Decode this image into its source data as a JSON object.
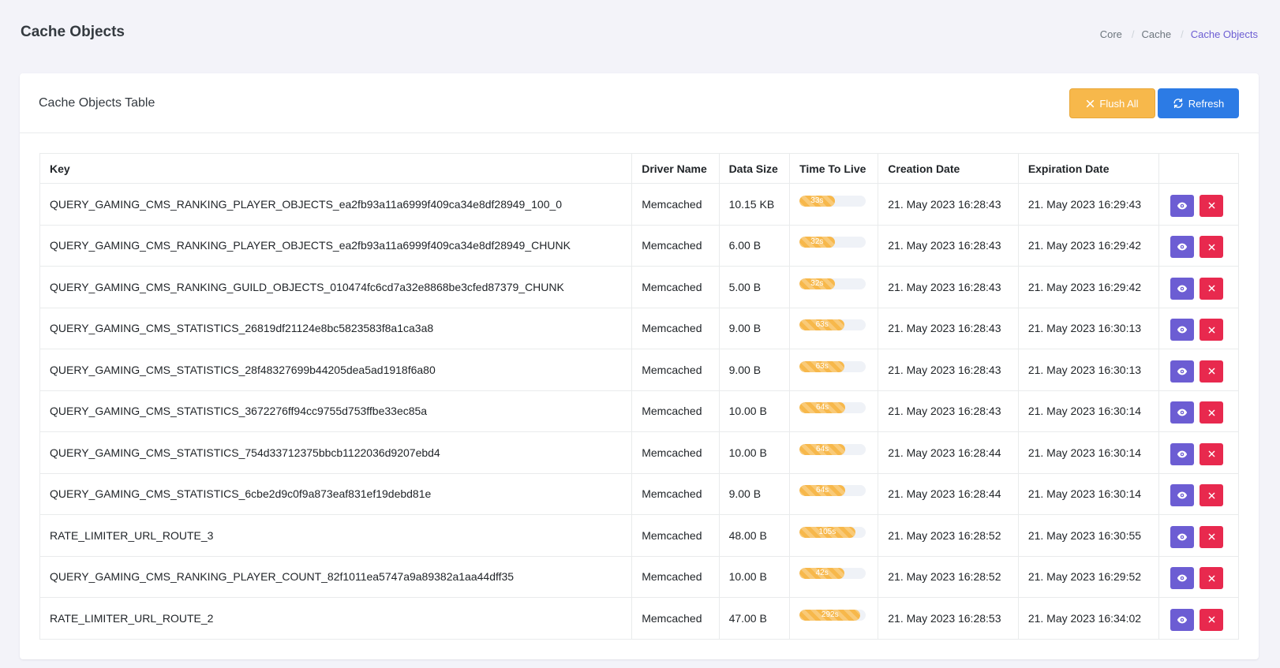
{
  "header": {
    "title": "Cache Objects",
    "breadcrumb": [
      "Core",
      "Cache",
      "Cache Objects"
    ]
  },
  "card": {
    "title": "Cache Objects Table",
    "flush_label": "Flush All",
    "refresh_label": "Refresh"
  },
  "table": {
    "columns": [
      "Key",
      "Driver Name",
      "Data Size",
      "Time To Live",
      "Creation Date",
      "Expiration Date",
      ""
    ],
    "rows": [
      {
        "key": "QUERY_GAMING_CMS_RANKING_PLAYER_OBJECTS_ea2fb93a11a6999f409ca34e8df28949_100_0",
        "driver": "Memcached",
        "size": "10.15 KB",
        "ttl": "33s",
        "ttl_fraction": 0.53,
        "created": "21. May 2023 16:28:43",
        "expires": "21. May 2023 16:29:43"
      },
      {
        "key": "QUERY_GAMING_CMS_RANKING_PLAYER_OBJECTS_ea2fb93a11a6999f409ca34e8df28949_CHUNK",
        "driver": "Memcached",
        "size": "6.00 B",
        "ttl": "32s",
        "ttl_fraction": 0.53,
        "created": "21. May 2023 16:28:43",
        "expires": "21. May 2023 16:29:42"
      },
      {
        "key": "QUERY_GAMING_CMS_RANKING_GUILD_OBJECTS_010474fc6cd7a32e8868be3cfed87379_CHUNK",
        "driver": "Memcached",
        "size": "5.00 B",
        "ttl": "32s",
        "ttl_fraction": 0.53,
        "created": "21. May 2023 16:28:43",
        "expires": "21. May 2023 16:29:42"
      },
      {
        "key": "QUERY_GAMING_CMS_STATISTICS_26819df21124e8bc5823583f8a1ca3a8",
        "driver": "Memcached",
        "size": "9.00 B",
        "ttl": "63s",
        "ttl_fraction": 0.68,
        "created": "21. May 2023 16:28:43",
        "expires": "21. May 2023 16:30:13"
      },
      {
        "key": "QUERY_GAMING_CMS_STATISTICS_28f48327699b44205dea5ad1918f6a80",
        "driver": "Memcached",
        "size": "9.00 B",
        "ttl": "63s",
        "ttl_fraction": 0.68,
        "created": "21. May 2023 16:28:43",
        "expires": "21. May 2023 16:30:13"
      },
      {
        "key": "QUERY_GAMING_CMS_STATISTICS_3672276ff94cc9755d753ffbe33ec85a",
        "driver": "Memcached",
        "size": "10.00 B",
        "ttl": "64s",
        "ttl_fraction": 0.69,
        "created": "21. May 2023 16:28:43",
        "expires": "21. May 2023 16:30:14"
      },
      {
        "key": "QUERY_GAMING_CMS_STATISTICS_754d33712375bbcb1122036d9207ebd4",
        "driver": "Memcached",
        "size": "10.00 B",
        "ttl": "64s",
        "ttl_fraction": 0.69,
        "created": "21. May 2023 16:28:44",
        "expires": "21. May 2023 16:30:14"
      },
      {
        "key": "QUERY_GAMING_CMS_STATISTICS_6cbe2d9c0f9a873eaf831ef19debd81e",
        "driver": "Memcached",
        "size": "9.00 B",
        "ttl": "64s",
        "ttl_fraction": 0.69,
        "created": "21. May 2023 16:28:44",
        "expires": "21. May 2023 16:30:14"
      },
      {
        "key": "RATE_LIMITER_URL_ROUTE_3",
        "driver": "Memcached",
        "size": "48.00 B",
        "ttl": "105s",
        "ttl_fraction": 0.84,
        "created": "21. May 2023 16:28:52",
        "expires": "21. May 2023 16:30:55"
      },
      {
        "key": "QUERY_GAMING_CMS_RANKING_PLAYER_COUNT_82f1011ea5747a9a89382a1aa44dff35",
        "driver": "Memcached",
        "size": "10.00 B",
        "ttl": "42s",
        "ttl_fraction": 0.68,
        "created": "21. May 2023 16:28:52",
        "expires": "21. May 2023 16:29:52"
      },
      {
        "key": "RATE_LIMITER_URL_ROUTE_2",
        "driver": "Memcached",
        "size": "47.00 B",
        "ttl": "292s",
        "ttl_fraction": 0.92,
        "created": "21. May 2023 16:28:53",
        "expires": "21. May 2023 16:34:02"
      }
    ]
  },
  "icons": {
    "flush": "close-icon",
    "refresh": "refresh-icon",
    "view": "eye-icon",
    "delete": "close-icon"
  },
  "colors": {
    "background": "#f3f3f9",
    "warning": "#f7b84b",
    "primary": "#2c7be5",
    "view": "#6c5dd3",
    "danger": "#e8294e",
    "breadcrumb_active": "#6c5dd3"
  }
}
